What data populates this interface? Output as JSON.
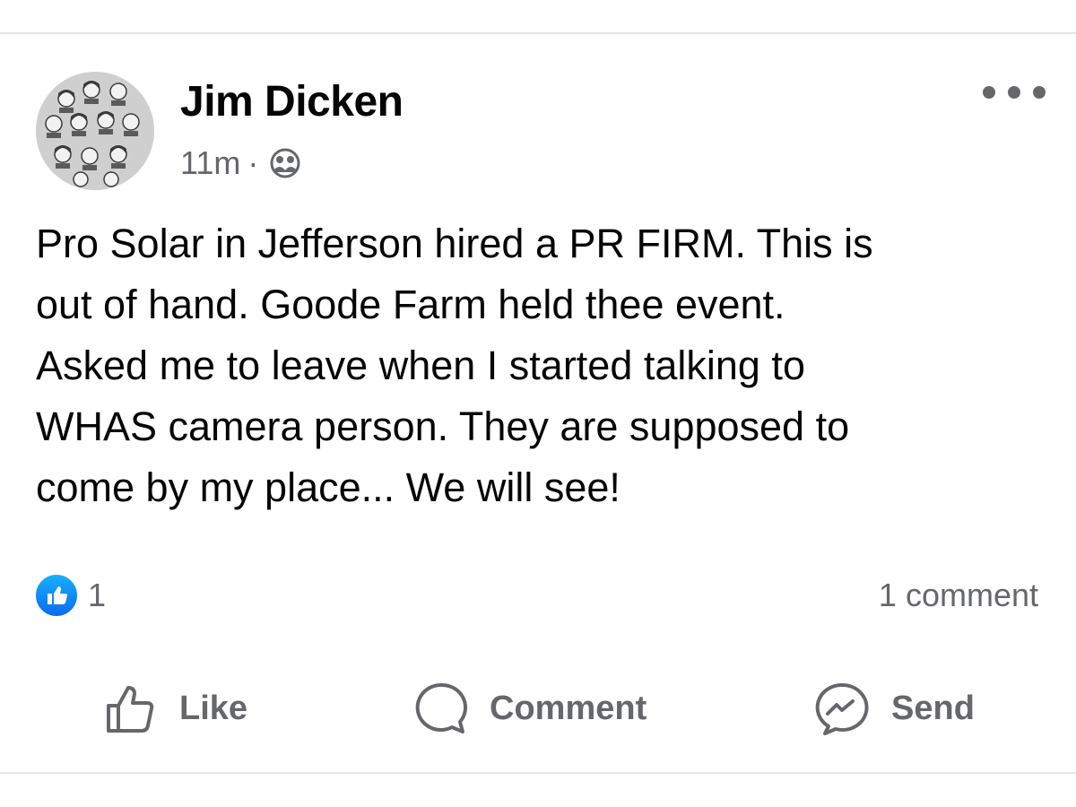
{
  "post": {
    "author": "Jim Dicken",
    "timestamp": "11m",
    "separator": "·",
    "audience_icon": "friends-icon",
    "more_icon": "more-options-icon",
    "text_lines": [
      "Pro Solar in Jefferson hired a PR FIRM. This is",
      "out of hand. Goode Farm held thee event.",
      "Asked me to leave when I started talking to",
      "WHAS camera person. They are supposed to",
      "come by my place... We will see!"
    ]
  },
  "stats": {
    "reaction_icon": "like-reaction-icon",
    "reaction_count": "1",
    "comment_count": "1 comment"
  },
  "actions": {
    "like_label": "Like",
    "comment_label": "Comment",
    "send_label": "Send"
  },
  "colors": {
    "text_primary": "#050505",
    "text_secondary": "#65676b",
    "like_blue": "#1877f2",
    "divider": "#e4e6eb"
  }
}
